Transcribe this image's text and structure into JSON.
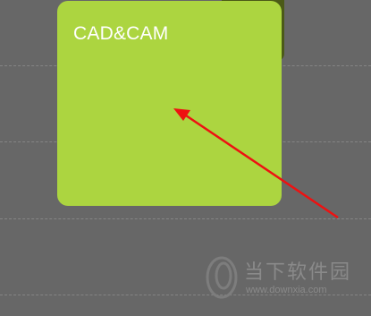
{
  "tile": {
    "title": "CAD&CAM",
    "color": "#acd540"
  },
  "annotation": {
    "arrow_color": "#ee1111",
    "arrow_icon": "red-arrow-icon"
  },
  "watermark": {
    "site_name_cn": "当下软件园",
    "url": "www.downxia.com",
    "logo_icon": "downxia-logo-icon"
  }
}
